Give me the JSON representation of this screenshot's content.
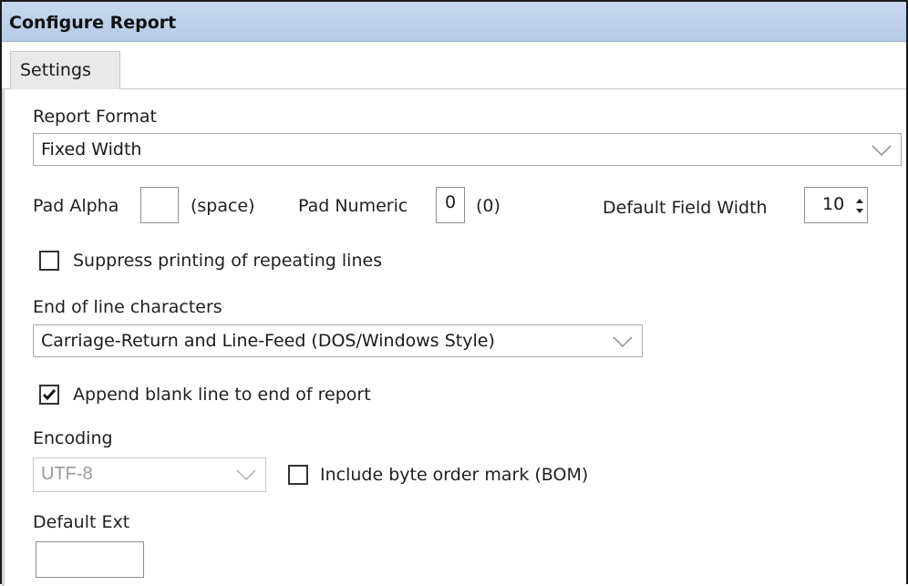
{
  "window": {
    "title": "Configure Report"
  },
  "tabs": [
    {
      "label": "Settings"
    }
  ],
  "report_format": {
    "label": "Report Format",
    "value": "Fixed Width"
  },
  "padding": {
    "pad_alpha_label": "Pad Alpha",
    "pad_alpha_value": "",
    "pad_alpha_hint": "(space)",
    "pad_numeric_label": "Pad Numeric",
    "pad_numeric_value": "0",
    "pad_numeric_hint": "(0)",
    "default_width_label": "Default Field Width",
    "default_width_value": "10"
  },
  "suppress": {
    "label": "Suppress printing of repeating lines",
    "checked": false
  },
  "eol": {
    "label": "End of line characters",
    "value": "Carriage-Return and Line-Feed (DOS/Windows Style)"
  },
  "append_blank": {
    "label": "Append blank line to end of report",
    "checked": true
  },
  "encoding": {
    "label": "Encoding",
    "value": "UTF-8",
    "enabled": false
  },
  "bom": {
    "label": "Include byte order mark (BOM)",
    "checked": false
  },
  "default_ext": {
    "label": "Default Ext",
    "value": ""
  },
  "colors": {
    "titlebar": "#c7d8ef",
    "tab": "#e9e9e9",
    "disabled_text": "#9a9a9a"
  }
}
